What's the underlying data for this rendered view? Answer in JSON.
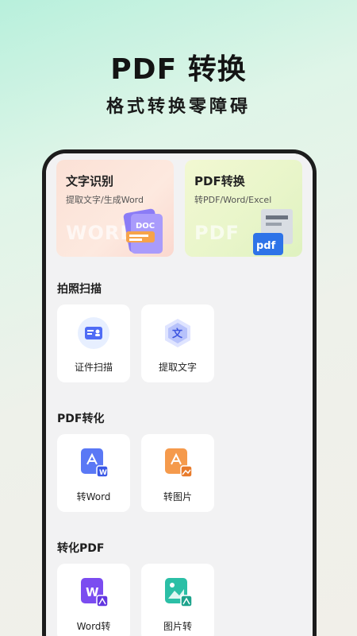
{
  "hero": {
    "title": "PDF 转换",
    "subtitle": "格式转换零障碍"
  },
  "features": [
    {
      "title": "文字识别",
      "desc": "提取文字/生成Word",
      "watermark": "WORD",
      "badge": "DOC"
    },
    {
      "title": "PDF转换",
      "desc": "转PDF/Word/Excel",
      "watermark": "PDF",
      "badge": "pdf"
    }
  ],
  "sections": [
    {
      "title": "拍照扫描",
      "items": [
        {
          "label": "证件扫描",
          "icon": "id-card-icon"
        },
        {
          "label": "提取文字",
          "icon": "text-extract-icon",
          "glyph": "文"
        }
      ]
    },
    {
      "title": "PDF转化",
      "items": [
        {
          "label": "转Word",
          "icon": "pdf-to-word-icon",
          "badge": "W"
        },
        {
          "label": "转图片",
          "icon": "pdf-to-image-icon"
        }
      ]
    },
    {
      "title": "转化PDF",
      "items": [
        {
          "label": "Word转",
          "icon": "word-to-pdf-icon",
          "badge": "W"
        },
        {
          "label": "图片转",
          "icon": "image-to-pdf-icon"
        }
      ]
    }
  ],
  "colors": {
    "accent_blue": "#4f6cf5",
    "accent_orange": "#f28a3c",
    "accent_purple": "#7b4cf0",
    "accent_teal": "#2bbfa6"
  }
}
